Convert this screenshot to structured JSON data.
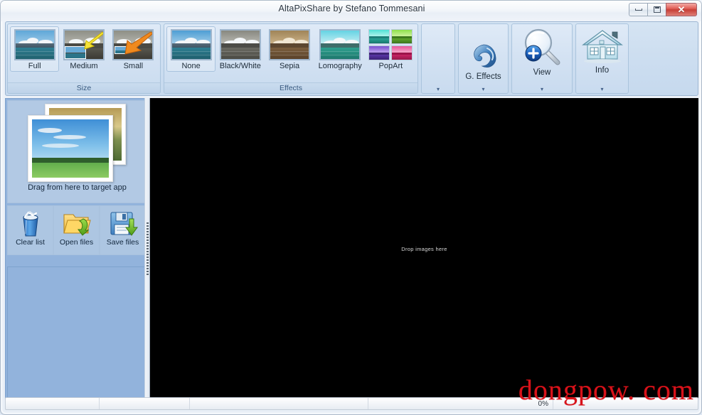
{
  "window": {
    "title": "AltaPixShare by Stefano Tommesani",
    "minimize_label": "Minimize",
    "maximize_label": "Maximize",
    "close_label": "Close",
    "close_glyph": "✕"
  },
  "ribbon": {
    "groups": [
      {
        "name": "size",
        "title": "Size",
        "items": [
          {
            "label": "Full",
            "icon": "landscape-full-thumbnail",
            "selected": true
          },
          {
            "label": "Medium",
            "icon": "landscape-medium-thumbnail",
            "selected": false
          },
          {
            "label": "Small",
            "icon": "landscape-small-thumbnail",
            "selected": false
          }
        ]
      },
      {
        "name": "effects",
        "title": "Effects",
        "items": [
          {
            "label": "None",
            "icon": "effect-none-thumbnail",
            "selected": true
          },
          {
            "label": "Black/White",
            "icon": "effect-blackwhite-thumbnail",
            "selected": false
          },
          {
            "label": "Sepia",
            "icon": "effect-sepia-thumbnail",
            "selected": false
          },
          {
            "label": "Lomography",
            "icon": "effect-lomography-thumbnail",
            "selected": false
          },
          {
            "label": "PopArt",
            "icon": "effect-popart-thumbnail",
            "selected": false
          }
        ]
      }
    ],
    "command_groups": [
      {
        "name": "empty",
        "label": "",
        "icon": "",
        "dropdown": "▾"
      },
      {
        "name": "g-effects",
        "label": "G. Effects",
        "icon": "swirl-icon",
        "dropdown": "▾"
      },
      {
        "name": "view",
        "label": "View",
        "icon": "magnifier-plus-icon",
        "dropdown": "▾"
      },
      {
        "name": "info",
        "label": "Info",
        "icon": "house-icon",
        "dropdown": "▾"
      }
    ],
    "size_group_dropdown": "▾"
  },
  "left_panel": {
    "drag_source_label": "Drag from here to target app",
    "drag_source_icon": "photo-stack-icon",
    "tools": [
      {
        "label": "Clear list",
        "icon": "recycle-bin-icon"
      },
      {
        "label": "Open files",
        "icon": "open-folder-icon"
      },
      {
        "label": "Save files",
        "icon": "floppy-save-icon"
      }
    ]
  },
  "canvas": {
    "drop_hint": "Drop images here"
  },
  "statusbar": {
    "cells": [
      "",
      "",
      "",
      "",
      ""
    ],
    "progress_text": "0%"
  },
  "watermark": {
    "text": "dongpow. com"
  },
  "colors": {
    "ribbon_bg": "#cddef0",
    "panel_blue": "#92b3dc",
    "canvas_bg": "#000000",
    "accent_close": "#c73f37",
    "watermark_red": "#d8121a"
  }
}
